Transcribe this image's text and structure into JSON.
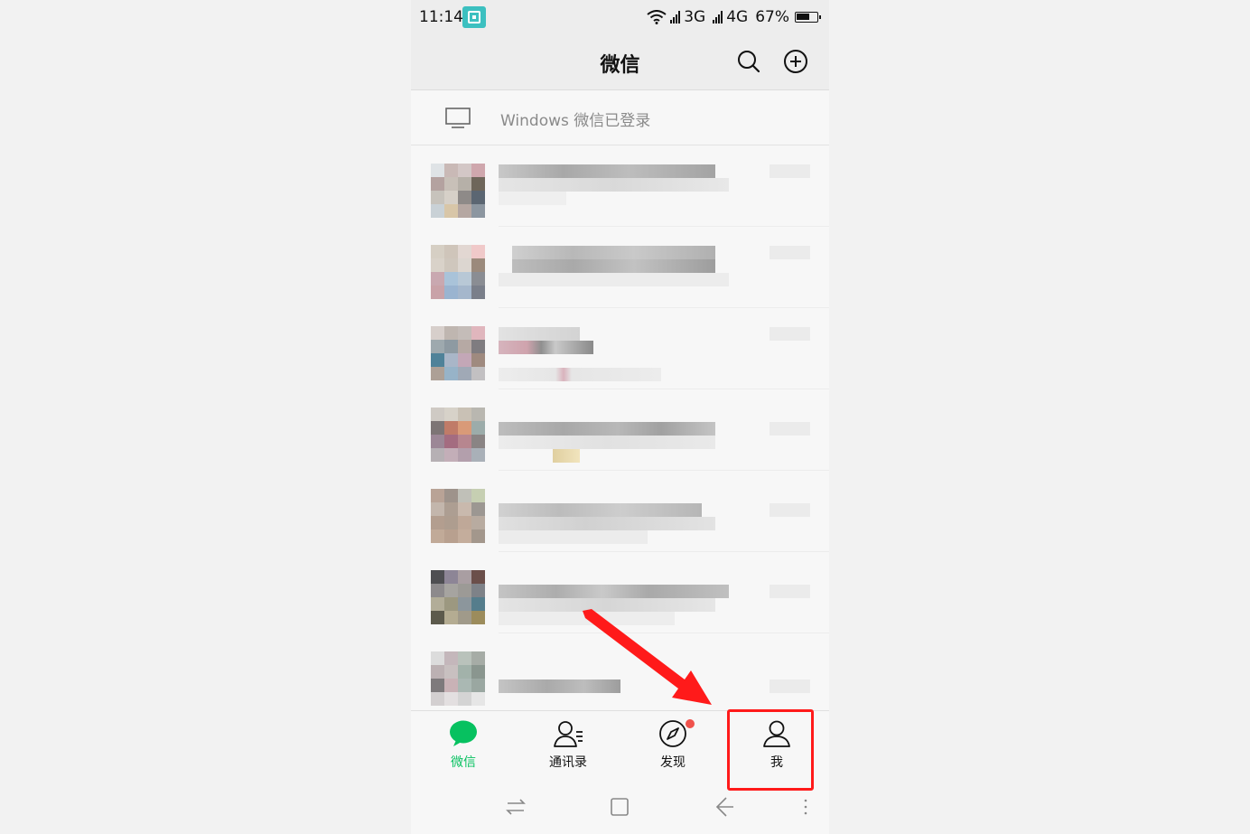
{
  "status_bar": {
    "time": "11:14",
    "network_3g": "3G",
    "network_4g": "4G",
    "battery": "67%",
    "battery_level": 0.67
  },
  "header": {
    "title": "微信",
    "search_icon": "search-icon",
    "add_icon": "plus-circle-icon"
  },
  "login_notice": {
    "text": "Windows 微信已登录",
    "icon": "monitor-icon"
  },
  "tabs": [
    {
      "label": "微信",
      "icon": "chat-bubble-icon",
      "active": true
    },
    {
      "label": "通讯录",
      "icon": "contacts-icon",
      "active": false
    },
    {
      "label": "发现",
      "icon": "compass-icon",
      "active": false,
      "badge": "dot"
    },
    {
      "label": "我",
      "icon": "person-icon",
      "active": false
    }
  ],
  "nav_bar": {
    "icons": [
      "switch-icon",
      "home-square-icon",
      "back-icon",
      "menu-icon"
    ]
  },
  "colors": {
    "accent": "#07c160",
    "highlight": "#ff1a1a",
    "badge": "#f0524c"
  }
}
